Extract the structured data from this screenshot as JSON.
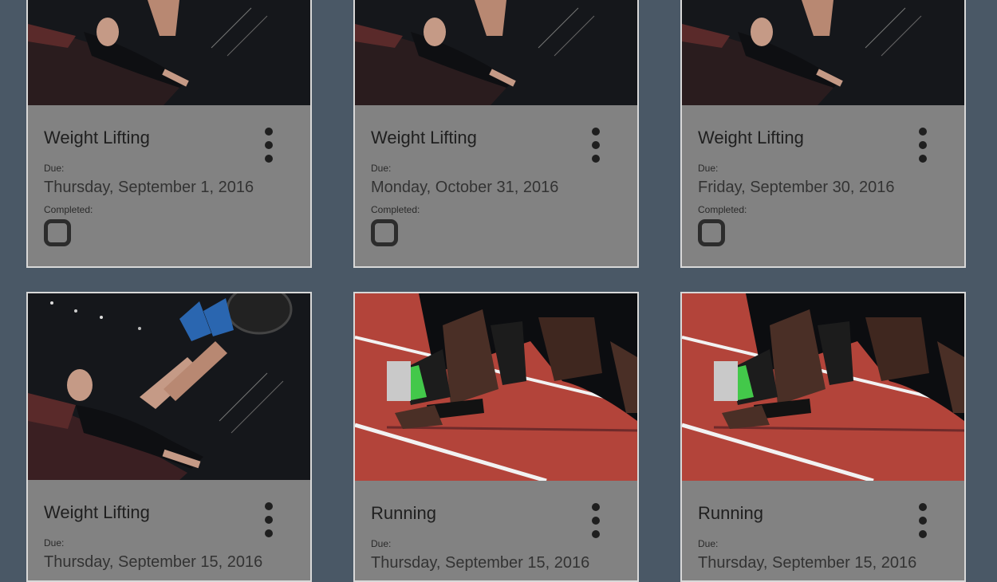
{
  "labels": {
    "due": "Due:",
    "completed": "Completed:"
  },
  "cards": [
    {
      "title": "Weight Lifting",
      "due_date": "Thursday, September 1, 2016",
      "completed": false,
      "image": "weight-lifting-photo"
    },
    {
      "title": "Weight Lifting",
      "due_date": "Monday, October 31, 2016",
      "completed": false,
      "image": "weight-lifting-photo"
    },
    {
      "title": "Weight Lifting",
      "due_date": "Friday, September 30, 2016",
      "completed": false,
      "image": "weight-lifting-photo"
    },
    {
      "title": "Weight Lifting",
      "due_date": "Thursday, September 15, 2016",
      "completed": false,
      "image": "weight-lifting-photo"
    },
    {
      "title": "Running",
      "due_date": "Thursday, September 15, 2016",
      "completed": false,
      "image": "running-track-photo"
    },
    {
      "title": "Running",
      "due_date": "Thursday, September 15, 2016",
      "completed": false,
      "image": "running-track-photo"
    }
  ],
  "colors": {
    "background": "#4a5866",
    "card": "#828282",
    "card_border": "#d8d8d8",
    "text": "#1f1f1f",
    "track": "#b3443a"
  }
}
